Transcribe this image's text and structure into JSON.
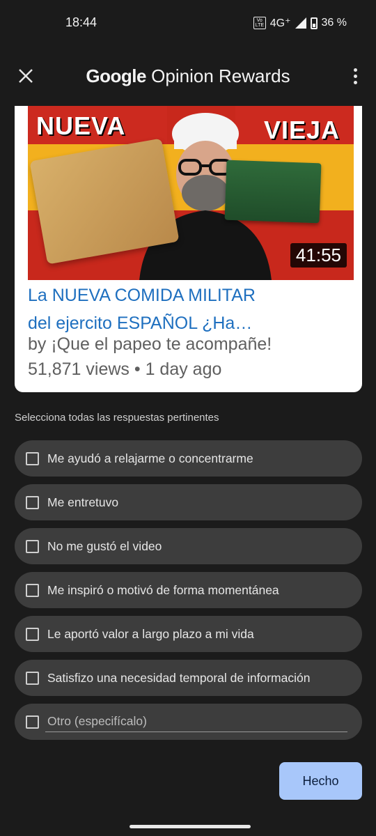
{
  "status_bar": {
    "time": "18:44",
    "volte": "Vo LTE",
    "network": "4G⁺",
    "battery": "36 %"
  },
  "app_bar": {
    "title_brand": "Google",
    "title_rest": " Opinion Rewards",
    "close_icon": "close-icon",
    "more_icon": "more-vert-icon"
  },
  "video": {
    "thumb_label_left": "NUEVA",
    "thumb_label_right": "VIEJA",
    "duration": "41:55",
    "title_line1": "La NUEVA COMIDA MILITAR",
    "title_line2": "del ejercito ESPAÑOL ¿Ha…",
    "channel": "by ¡Que el papeo te acompañe!",
    "meta": "51,871 views • 1 day ago"
  },
  "question": {
    "prompt": "Selecciona todas las respuestas pertinentes",
    "options": [
      "Me ayudó a relajarme o concentrarme",
      "Me entretuvo",
      "No me gustó el video",
      "Me inspiró o motivó de forma momentánea",
      "Le aportó valor a largo plazo a mi vida",
      "Satisfizo una necesidad temporal de información"
    ],
    "other_placeholder": "Otro (especifícalo)"
  },
  "actions": {
    "done_label": "Hecho"
  },
  "colors": {
    "background": "#1b1b1b",
    "option_bg": "#3d3d3d",
    "link_blue": "#1e6fbf",
    "button_bg": "#a8c7fa"
  }
}
